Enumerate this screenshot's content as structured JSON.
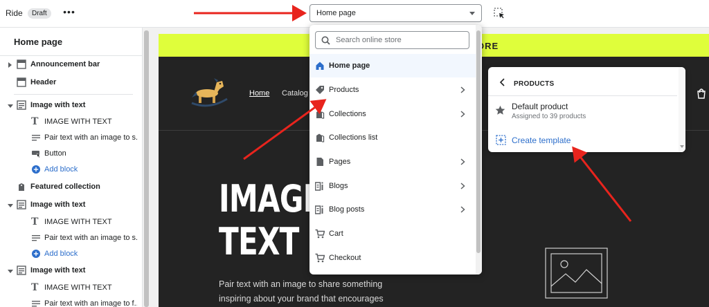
{
  "topbar": {
    "app_name": "Ride",
    "status_badge": "Draft",
    "more_label": "•••",
    "page_selector_value": "Home page"
  },
  "sidebar": {
    "title": "Home page",
    "rows": [
      {
        "label": "Announcement bar",
        "icon": "section-icon"
      },
      {
        "label": "Header",
        "icon": "section-icon"
      },
      {
        "label": "Image with text",
        "icon": "image-text-icon"
      },
      {
        "label": "IMAGE WITH TEXT",
        "icon": "text-icon"
      },
      {
        "label": "Pair text with an image to s...",
        "icon": "paragraph-icon"
      },
      {
        "label": "Button",
        "icon": "button-icon"
      },
      {
        "label": "Add block",
        "icon": "plus-circle-icon"
      },
      {
        "label": "Featured collection",
        "icon": "collection-icon"
      },
      {
        "label": "Image with text",
        "icon": "image-text-icon"
      },
      {
        "label": "IMAGE WITH TEXT",
        "icon": "text-icon"
      },
      {
        "label": "Pair text with an image to s...",
        "icon": "paragraph-icon"
      },
      {
        "label": "Add block",
        "icon": "plus-circle-icon"
      },
      {
        "label": "Image with text",
        "icon": "image-text-icon"
      },
      {
        "label": "IMAGE WITH TEXT",
        "icon": "text-icon"
      },
      {
        "label": "Pair text with an image to f...",
        "icon": "paragraph-icon"
      }
    ]
  },
  "dropdown": {
    "search_placeholder": "Search online store",
    "items": [
      {
        "label": "Home page",
        "icon": "home-icon",
        "submenu": false,
        "active": true
      },
      {
        "label": "Products",
        "icon": "tag-icon",
        "submenu": true
      },
      {
        "label": "Collections",
        "icon": "collection-icon",
        "submenu": true
      },
      {
        "label": "Collections list",
        "icon": "collection-icon",
        "submenu": false
      },
      {
        "label": "Pages",
        "icon": "page-icon",
        "submenu": true
      },
      {
        "label": "Blogs",
        "icon": "blog-icon",
        "submenu": true
      },
      {
        "label": "Blog posts",
        "icon": "blog-icon",
        "submenu": true
      },
      {
        "label": "Cart",
        "icon": "cart-icon",
        "submenu": false
      },
      {
        "label": "Checkout",
        "icon": "cart-icon",
        "submenu": false
      }
    ]
  },
  "popover": {
    "title": "PRODUCTS",
    "template_name": "Default product",
    "template_sub": "Assigned to 39 products",
    "create_label": "Create template"
  },
  "preview": {
    "announcement": "ORE",
    "nav_home": "Home",
    "nav_catalog": "Catalog",
    "hero_line1": "IMAGE",
    "hero_line2": "TEXT",
    "hero_copy_1": "Pair text with an image to share something",
    "hero_copy_2": "inspiring about your brand that encourages"
  },
  "colors": {
    "accent": "#2c6ecb",
    "announcement_bg": "#dffe3b",
    "preview_bg": "#232323",
    "annotation_arrow": "#e8241d"
  }
}
